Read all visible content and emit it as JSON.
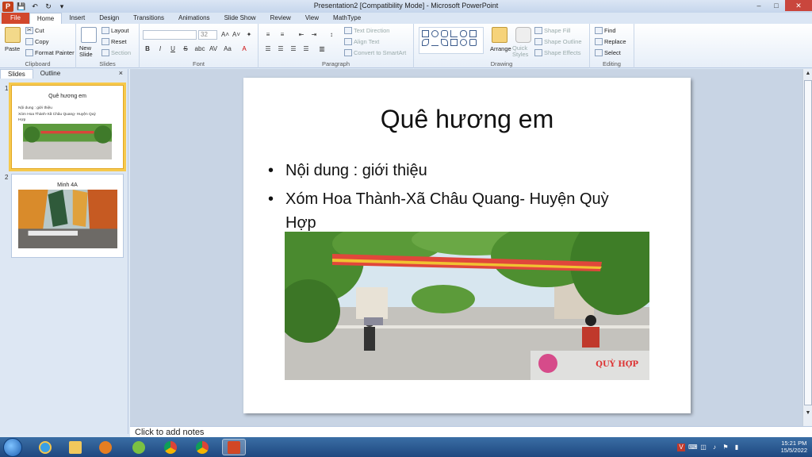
{
  "window": {
    "title": "Presentation2 [Compatibility Mode]  -  Microsoft PowerPoint",
    "app_icon": "P"
  },
  "tabs": [
    "File",
    "Home",
    "Insert",
    "Design",
    "Transitions",
    "Animations",
    "Slide Show",
    "Review",
    "View",
    "MathType"
  ],
  "ribbon": {
    "clipboard": {
      "label": "Clipboard",
      "paste": "Paste",
      "cut": "Cut",
      "copy": "Copy",
      "format_painter": "Format Painter"
    },
    "slides": {
      "label": "Slides",
      "new_slide": "New Slide",
      "layout": "Layout",
      "reset": "Reset",
      "section": "Section"
    },
    "font": {
      "label": "Font",
      "size": "32",
      "bold": "B",
      "italic": "I",
      "underline": "U",
      "strike": "S",
      "shadow": "abc",
      "spacing": "AV",
      "case": "Aa",
      "color": "A"
    },
    "paragraph": {
      "label": "Paragraph",
      "text_direction": "Text Direction",
      "align_text": "Align Text",
      "convert_smartart": "Convert to SmartArt"
    },
    "drawing": {
      "label": "Drawing",
      "arrange": "Arrange",
      "quick_styles": "Quick Styles",
      "shape_fill": "Shape Fill",
      "shape_outline": "Shape Outline",
      "shape_effects": "Shape Effects"
    },
    "editing": {
      "label": "Editing",
      "find": "Find",
      "replace": "Replace",
      "select": "Select"
    }
  },
  "pane": {
    "tabs": [
      "Slides",
      "Outline"
    ],
    "close": "×",
    "thumbnails": [
      {
        "num": "1",
        "title": "Quê hương em",
        "bullets": [
          "Nội dung : giới thiệu",
          "Xóm Hoa Thành-Xã Châu Quang- Huyện Quỳ",
          "Hợp"
        ]
      },
      {
        "num": "2",
        "title": "Minh 4A"
      }
    ]
  },
  "slide": {
    "title": "Quê hương em",
    "bullets": [
      "Nội dung : giới thiệu",
      " Xóm Hoa Thành-Xã Châu Quang- Huyện Quỳ Hợp"
    ],
    "bullet_glyph": "•",
    "photo_watermark": "QUỲ HỢP"
  },
  "notes": {
    "placeholder": "Click to add notes"
  },
  "taskbar": {
    "apps": [
      "ie-icon",
      "folder-icon",
      "media-icon",
      "chrome-icon",
      "chrome-profile-icon",
      "powerpoint-icon"
    ],
    "clock_time": "15:21 PM",
    "clock_date": "15/5/2022",
    "tray_v": "V"
  },
  "colors": {
    "file_tab": "#d2472c",
    "selection": "#f6c94d",
    "taskbar": "#1f4880"
  }
}
